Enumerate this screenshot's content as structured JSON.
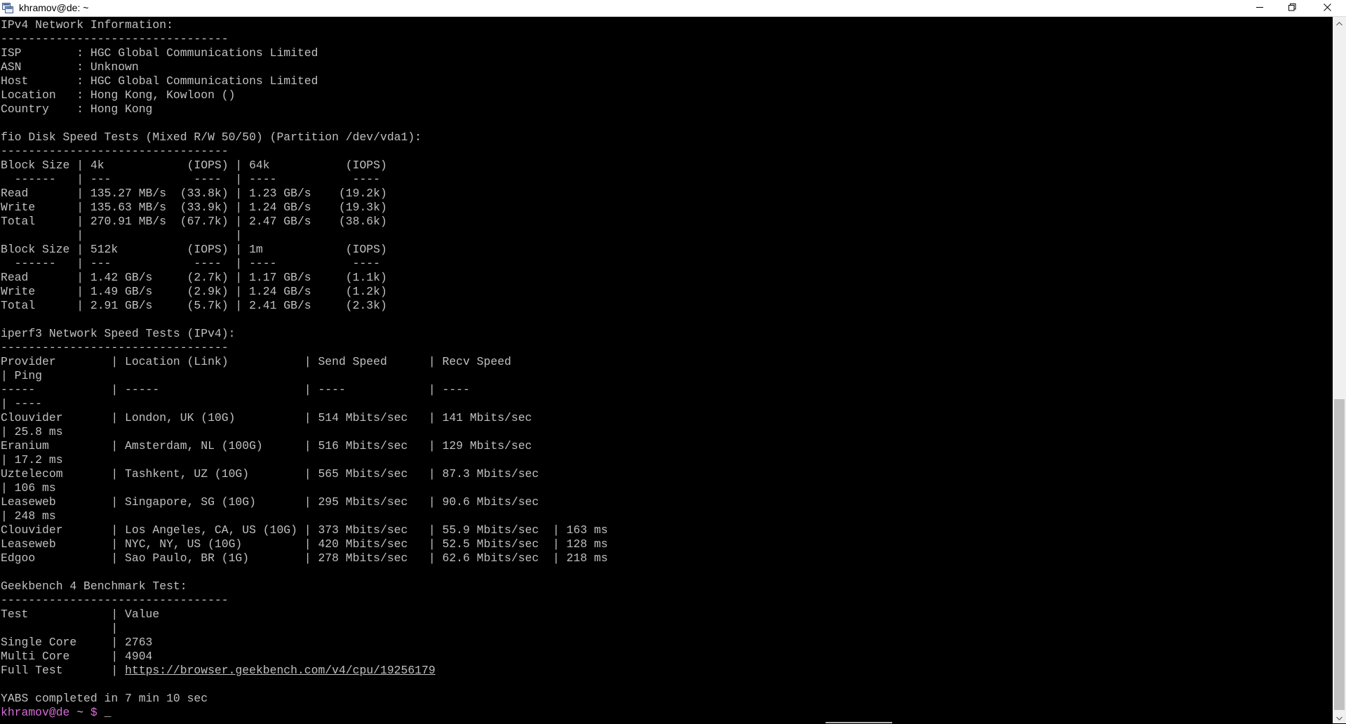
{
  "window": {
    "title": "khramov@de: ~",
    "colors": {
      "terminal_bg": "#000000",
      "terminal_fg": "#c0c0c0",
      "prompt_user": "#d86bd6",
      "titlebar_bg": "#ffffff"
    },
    "icons": [
      "terminal-app-icon",
      "minimize-icon",
      "maximize-icon",
      "close-icon"
    ]
  },
  "terminal": {
    "lines": [
      "IPv4 Network Information:",
      "---------------------------------",
      "ISP        : HGC Global Communications Limited",
      "ASN        : Unknown",
      "Host       : HGC Global Communications Limited",
      "Location   : Hong Kong, Kowloon ()",
      "Country    : Hong Kong",
      "",
      "fio Disk Speed Tests (Mixed R/W 50/50) (Partition /dev/vda1):",
      "---------------------------------",
      "Block Size | 4k            (IOPS) | 64k           (IOPS)",
      "  ------   | ---            ----  | ----           ----",
      "Read       | 135.27 MB/s  (33.8k) | 1.23 GB/s    (19.2k)",
      "Write      | 135.63 MB/s  (33.9k) | 1.24 GB/s    (19.3k)",
      "Total      | 270.91 MB/s  (67.7k) | 2.47 GB/s    (38.6k)",
      "           |                      |",
      "Block Size | 512k          (IOPS) | 1m            (IOPS)",
      "  ------   | ---            ----  | ----           ----",
      "Read       | 1.42 GB/s     (2.7k) | 1.17 GB/s     (1.1k)",
      "Write      | 1.49 GB/s     (2.9k) | 1.24 GB/s     (1.2k)",
      "Total      | 2.91 GB/s     (5.7k) | 2.41 GB/s     (2.3k)",
      "",
      "iperf3 Network Speed Tests (IPv4):",
      "---------------------------------",
      "Provider        | Location (Link)           | Send Speed      | Recv Speed",
      "| Ping",
      "-----           | -----                     | ----            | ----",
      "| ----",
      "Clouvider       | London, UK (10G)          | 514 Mbits/sec   | 141 Mbits/sec",
      "| 25.8 ms",
      "Eranium         | Amsterdam, NL (100G)      | 516 Mbits/sec   | 129 Mbits/sec",
      "| 17.2 ms",
      "Uztelecom       | Tashkent, UZ (10G)        | 565 Mbits/sec   | 87.3 Mbits/sec",
      "| 106 ms",
      "Leaseweb        | Singapore, SG (10G)       | 295 Mbits/sec   | 90.6 Mbits/sec",
      "| 248 ms",
      "Clouvider       | Los Angeles, CA, US (10G) | 373 Mbits/sec   | 55.9 Mbits/sec  | 163 ms",
      "Leaseweb        | NYC, NY, US (10G)         | 420 Mbits/sec   | 52.5 Mbits/sec  | 128 ms",
      "Edgoo           | Sao Paulo, BR (1G)        | 278 Mbits/sec   | 62.6 Mbits/sec  | 218 ms",
      "",
      "Geekbench 4 Benchmark Test:",
      "---------------------------------",
      "Test            | Value",
      "                |",
      "Single Core     | 2763",
      "Multi Core      | 4904",
      "Full Test       | ",
      "",
      "YABS completed in 7 min 10 sec"
    ],
    "geekbench_link": "https://browser.geekbench.com/v4/cpu/19256179",
    "prompt": {
      "user_host": "khramov@de",
      "path": " ~ ",
      "symbol": "$",
      "cursor": "_"
    }
  }
}
